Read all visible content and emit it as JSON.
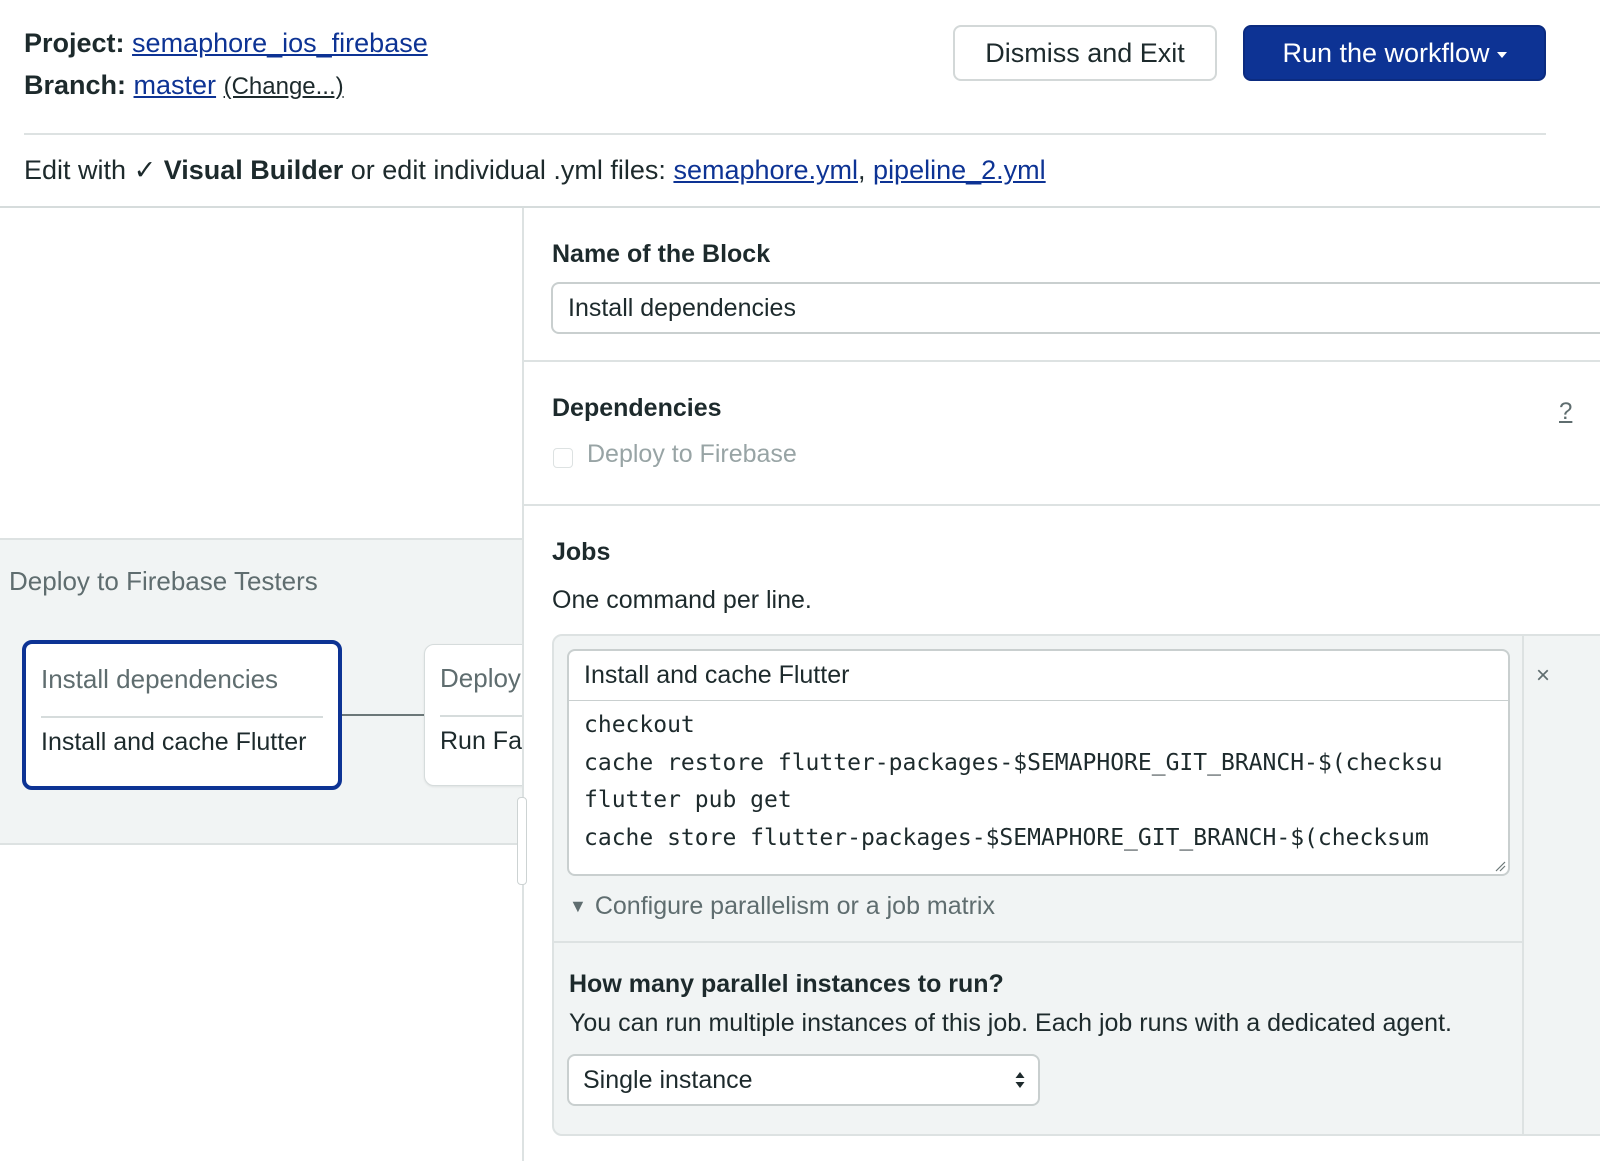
{
  "header": {
    "project_label": "Project:",
    "project_name": "semaphore_ios_firebase",
    "branch_label": "Branch:",
    "branch_name": "master",
    "change_link": "(Change...)",
    "dismiss_button": "Dismiss and Exit",
    "run_button": "Run the workflow"
  },
  "edit_bar": {
    "prefix": "Edit with",
    "check": "✓",
    "visual_builder": "Visual Builder",
    "middle": "or edit individual .yml files:",
    "files": [
      "semaphore.yml",
      "pipeline_2.yml"
    ],
    "separator": ","
  },
  "pipeline": {
    "title": "Deploy to Firebase Testers",
    "blocks": [
      {
        "name": "Install dependencies",
        "job": "Install and cache Flutter",
        "selected": true
      },
      {
        "name": "Deploy",
        "job": "Run Fas",
        "selected": false
      }
    ]
  },
  "editor": {
    "block_name_label": "Name of the Block",
    "block_name_value": "Install dependencies",
    "dependencies_label": "Dependencies",
    "dependencies_help": "?",
    "dependency_options": [
      {
        "label": "Deploy to Firebase",
        "checked": false,
        "disabled": true
      }
    ],
    "jobs_label": "Jobs",
    "jobs_hint": "One command per line.",
    "job": {
      "name": "Install and cache Flutter",
      "commands": [
        "checkout",
        "cache restore flutter-packages-$SEMAPHORE_GIT_BRANCH-$(checksu",
        "flutter pub get",
        "cache store flutter-packages-$SEMAPHORE_GIT_BRANCH-$(checksum"
      ],
      "remove_icon": "×",
      "disclosure_icon": "▼",
      "disclosure_label": "Configure parallelism or a job matrix",
      "parallel_title": "How many parallel instances to run?",
      "parallel_desc": "You can run multiple instances of this job. Each job runs with a dedicated agent.",
      "parallel_selected": "Single instance"
    }
  },
  "colors": {
    "brand": "#0d3394",
    "text": "#1d2a2c",
    "muted": "#5f6d6f",
    "panel_bg": "#f1f4f4",
    "border": "#dde2e2"
  }
}
